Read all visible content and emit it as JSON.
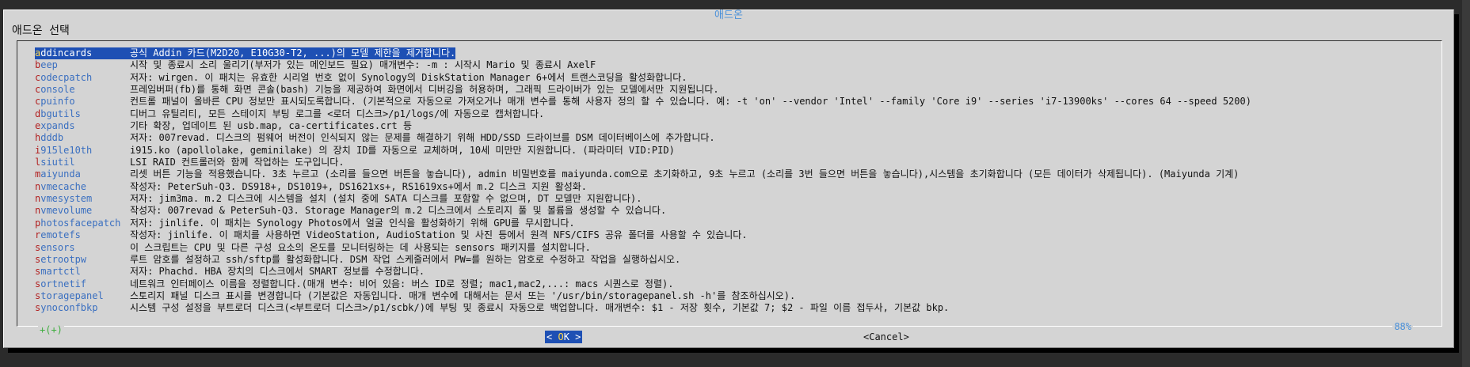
{
  "dialog": {
    "title": "애드온",
    "subtitle": "애드온 선택"
  },
  "items": [
    {
      "tag": "addincards",
      "desc": "공식 Addin 카드(M2D20, E10G30-T2, ...)의 모델 제한을 제거합니다.",
      "selected": true
    },
    {
      "tag": "beep",
      "desc": "시작 및 종료시 소리 울리기(부저가 있는 메인보드 필요) 매개변수: -m : 시작시 Mario 및 종료시 AxelF"
    },
    {
      "tag": "codecpatch",
      "desc": "저자: wirgen. 이 패치는 유효한 시리얼 번호 없이 Synology의 DiskStation Manager 6+에서 트랜스코딩을 활성화합니다."
    },
    {
      "tag": "console",
      "desc": "프레임버퍼(fb)를 통해 화면 콘솔(bash) 기능을 제공하여 화면에서 디버깅을 허용하며, 그래픽 드라이버가 있는 모델에서만 지원됩니다."
    },
    {
      "tag": "cpuinfo",
      "desc": "컨트롤 패널이 올바른 CPU 정보만 표시되도록합니다. (기본적으로 자동으로 가져오거나 매개 변수를 통해 사용자 정의 할 수 있습니다. 예: -t 'on' --vendor 'Intel' --family 'Core i9' --series 'i7-13900ks' --cores 64 --speed 5200)"
    },
    {
      "tag": "dbgutils",
      "desc": "디버그 유틸리티, 모든 스테이지 부팅 로그를 <로더 디스크>/p1/logs/에 자동으로 캡처합니다."
    },
    {
      "tag": "expands",
      "desc": "기타 확장, 업데이트 된 usb.map, ca-certificates.crt 등"
    },
    {
      "tag": "hdddb",
      "desc": "저자: 007revad. 디스크의 펌웨어 버전이 인식되지 않는 문제를 해결하기 위해 HDD/SSD 드라이브를 DSM 데이터베이스에 추가합니다."
    },
    {
      "tag": "i915le10th",
      "desc": "i915.ko (apollolake, geminilake) 의 장치 ID를 자동으로 교체하며, 10세 미만만 지원합니다. (파라미터 VID:PID)"
    },
    {
      "tag": "lsiutil",
      "desc": "LSI RAID 컨트롤러와 함께 작업하는 도구입니다."
    },
    {
      "tag": "maiyunda",
      "desc": "리셋 버튼 기능을 적용했습니다. 3초 누르고 (소리를 들으면 버튼을 놓습니다), admin 비밀번호를 maiyunda.com으로 초기화하고, 9초 누르고 (소리를 3번 들으면 버튼을 놓습니다),시스템을 초기화합니다 (모든 데이터가 삭제됩니다). (Maiyunda 기계)"
    },
    {
      "tag": "nvmecache",
      "desc": "작성자: PeterSuh-Q3. DS918+, DS1019+, DS1621xs+, RS1619xs+에서 m.2 디스크 지원 활성화."
    },
    {
      "tag": "nvmesystem",
      "desc": "저자: jim3ma. m.2 디스크에 시스템을 설치 (설치 중에 SATA 디스크를 포함할 수 없으며, DT 모델만 지원합니다)."
    },
    {
      "tag": "nvmevolume",
      "desc": "작성자: 007revad & PeterSuh-Q3. Storage Manager의 m.2 디스크에서 스토리지 풀 및 볼륨을 생성할 수 있습니다."
    },
    {
      "tag": "photosfacepatch",
      "desc": "저자: jinlife. 이 패치는 Synology Photos에서 얼굴 인식을 활성화하기 위해 GPU를 무시합니다."
    },
    {
      "tag": "remotefs",
      "desc": "작성자: jinlife. 이 패치를 사용하면 VideoStation, AudioStation 및 사진 등에서 원격 NFS/CIFS 공유 폴더를 사용할 수 있습니다."
    },
    {
      "tag": "sensors",
      "desc": "이 스크립트는 CPU 및 다른 구성 요소의 온도를 모니터링하는 데 사용되는 sensors 패키지를 설치합니다."
    },
    {
      "tag": "setrootpw",
      "desc": "루트 암호를 설정하고 ssh/sftp를 활성화합니다. DSM 작업 스케줄러에서 PW=를 원하는 암호로 수정하고 작업을 실행하십시오."
    },
    {
      "tag": "smartctl",
      "desc": "저자: Phachd. HBA 장치의 디스크에서 SMART 정보를 수정합니다."
    },
    {
      "tag": "sortnetif",
      "desc": "네트워크 인터페이스 이름을 정렬합니다.(매개 변수: 비어 있음: 버스 ID로 정렬; mac1,mac2,...: macs 시퀀스로 정렬)."
    },
    {
      "tag": "storagepanel",
      "desc": "스토리지 패널 디스크 표시를 변경합니다 (기본값은 자동입니다. 매개 변수에 대해서는 문서 또는 '/usr/bin/storagepanel.sh -h'를 참조하십시오)."
    },
    {
      "tag": "synoconfbkp",
      "desc": "시스템 구성 설정을 부트로더 디스크(<부트로더 디스크>/p1/scbk/)에 부팅 및 종료시 자동으로 백업합니다. 매개변수: $1 - 저장 횟수, 기본값 7; $2 - 파일 이름 접두사, 기본값 bkp."
    }
  ],
  "list": {
    "more_indicator": "+(+)",
    "percent": "88%"
  },
  "buttons": {
    "ok_left": "<",
    "ok_hot": "O",
    "ok_rest": "K",
    "ok_right": ">",
    "cancel": "<Cancel>"
  }
}
